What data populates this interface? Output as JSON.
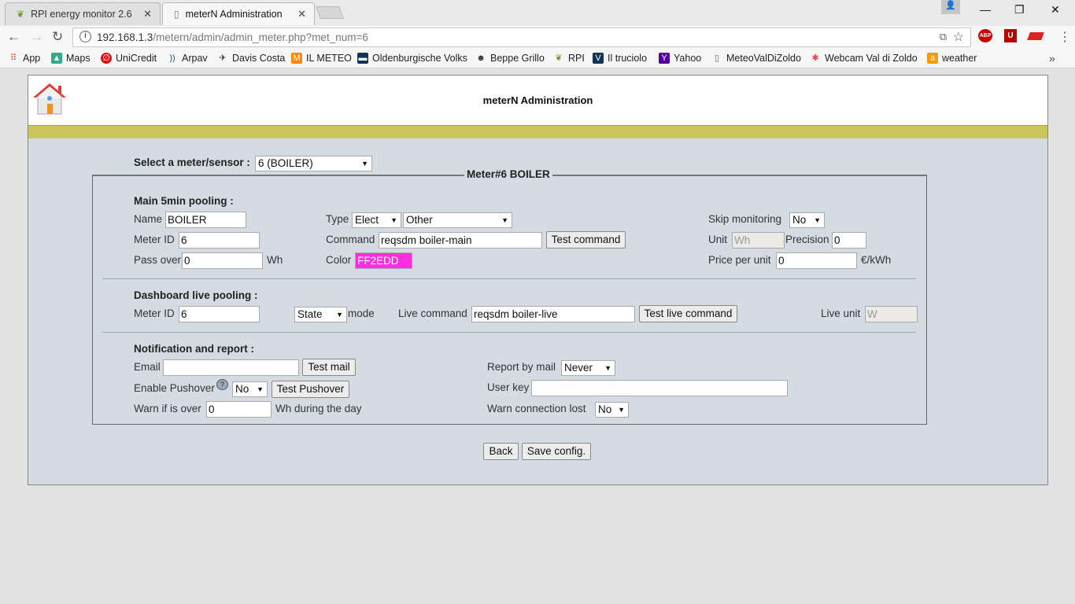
{
  "browser": {
    "tabs": [
      {
        "label": "RPI energy monitor 2.6",
        "active": false
      },
      {
        "label": "meterN Administration",
        "active": true
      }
    ],
    "url_host": "192.168.1.3",
    "url_path": "/metern/admin/admin_meter.php?met_num=6",
    "extensions": [
      "ABP"
    ],
    "bookmarks": [
      {
        "label": "App",
        "icon": "apps-grid-icon"
      },
      {
        "label": "Maps",
        "icon": "maps-icon"
      },
      {
        "label": "UniCredit",
        "icon": "unicredit-icon"
      },
      {
        "label": "Arpav",
        "icon": "arpav-icon"
      },
      {
        "label": "Davis Costa",
        "icon": "davis-icon"
      },
      {
        "label": "IL METEO",
        "icon": "ilmeteo-icon"
      },
      {
        "label": "Oldenburgische Volks",
        "icon": "bank-icon"
      },
      {
        "label": "Beppe Grillo",
        "icon": "grillo-icon"
      },
      {
        "label": "RPI",
        "icon": "rpi-icon"
      },
      {
        "label": "Il truciolo",
        "icon": "truciolo-icon"
      },
      {
        "label": "Yahoo",
        "icon": "yahoo-icon"
      },
      {
        "label": "MeteoValDiZoldo",
        "icon": "page-icon"
      },
      {
        "label": "Webcam Val di Zoldo",
        "icon": "webcam-icon"
      },
      {
        "label": "weather",
        "icon": "weather-icon"
      }
    ]
  },
  "header": {
    "title": "meterN Administration"
  },
  "selector": {
    "label": "Select a meter/sensor :",
    "value": "6 (BOILER)"
  },
  "fieldset": {
    "legend": "Meter#6 BOILER"
  },
  "main": {
    "heading": "Main 5min pooling :",
    "name_label": "Name",
    "name_value": "BOILER",
    "type_label": "Type",
    "type_value": "Elect",
    "subtype_value": "Other",
    "skip_label": "Skip monitoring",
    "skip_value": "No",
    "meterid_label": "Meter ID",
    "meterid_value": "6",
    "command_label": "Command",
    "command_value": "reqsdm boiler-main",
    "test_command": "Test command",
    "unit_label": "Unit",
    "unit_value": "Wh",
    "precision_label": "Precision",
    "precision_value": "0",
    "passover_label": "Pass over",
    "passover_value": "0",
    "passover_unit": "Wh",
    "color_label": "Color",
    "color_value": "FF2EDD",
    "price_label": "Price per unit",
    "price_value": "0",
    "price_unit": "€/kWh"
  },
  "live": {
    "heading": "Dashboard live pooling :",
    "meterid_label": "Meter ID",
    "meterid_value": "6",
    "mode_value": "State",
    "mode_label": "mode",
    "command_label": "Live command",
    "command_value": "reqsdm boiler-live",
    "test_button": "Test live command",
    "unit_label": "Live unit",
    "unit_value": "W"
  },
  "notify": {
    "heading": "Notification and report :",
    "email_label": "Email",
    "email_value": "",
    "test_mail": "Test mail",
    "report_label": "Report by mail",
    "report_value": "Never",
    "pushover_label": "Enable Pushover",
    "pushover_value": "No",
    "test_pushover": "Test Pushover",
    "userkey_label": "User key",
    "userkey_value": "",
    "warn_label": "Warn if is over",
    "warn_value": "0",
    "warn_suffix": "Wh during the day",
    "warnconn_label": "Warn connection lost",
    "warnconn_value": "No"
  },
  "footer": {
    "back": "Back",
    "save": "Save config."
  },
  "colors": {
    "accent_olive": "#c8c55a",
    "panel_bg": "#d4dbe3",
    "meter_color": "#FF2EDD"
  }
}
